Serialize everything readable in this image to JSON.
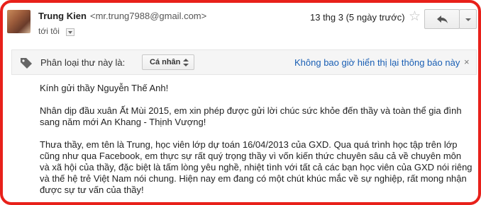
{
  "header": {
    "sender_name": "Trung Kien",
    "sender_email": "<mr.trung7988@gmail.com>",
    "recipient": "tới tôi",
    "date": "13 thg 3 (5 ngày trước)",
    "icons": {
      "avatar": "avatar-image",
      "star": "star-icon",
      "reply": "reply-icon",
      "more": "chevron-down-icon"
    }
  },
  "category_bar": {
    "label": "Phân loại thư này là:",
    "selected": "Cá nhân",
    "never_show": "Không bao giờ hiển thị lại thông báo này",
    "close": "×"
  },
  "body": {
    "greeting": "Kính gửi thầy Nguyễn Thế Anh!",
    "paragraph1": "Nhân dịp đầu xuân Ất Mùi 2015, em xin phép được gửi lời chúc sức khỏe đến thầy và toàn thể gia đình sang năm mới An Khang - Thịnh Vượng!",
    "paragraph2": "Thưa thầy, em tên là Trung, học viên lớp dự toán 16/04/2013 của GXD. Qua quá trình học tập trên lớp cũng như qua Facebook, em thực sự rất quý trọng thầy vì vốn kiến thức chuyên sâu cả về chuyên môn và xã hội của thầy, đặc biệt là tấm lòng yêu nghề, nhiệt tình với tất cả các bạn học viên của GXD nói riêng và thế hệ trẻ Việt Nam nói chung. Hiện nay em đang có một chút khúc mắc về sự nghiệp, rất mong nhận được sự tư vấn của thầy!"
  },
  "colors": {
    "frame_border": "#e8201a",
    "link": "#1a5fb4"
  }
}
